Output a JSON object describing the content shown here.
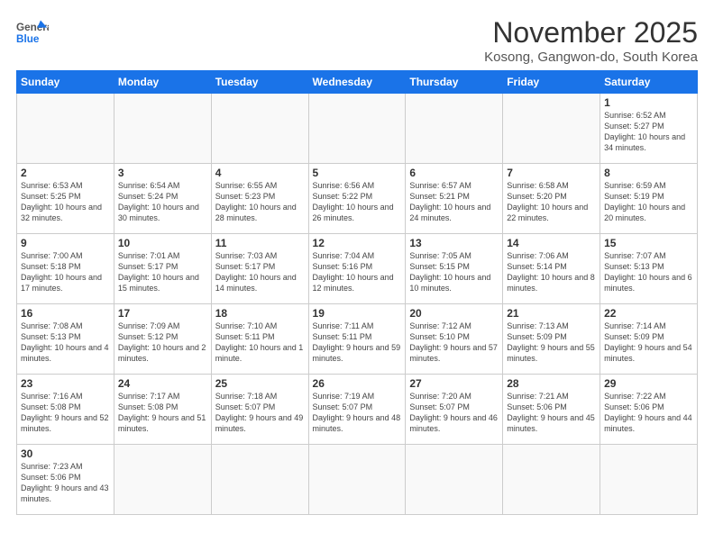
{
  "header": {
    "logo_general": "General",
    "logo_blue": "Blue",
    "title": "November 2025",
    "subtitle": "Kosong, Gangwon-do, South Korea"
  },
  "weekdays": [
    "Sunday",
    "Monday",
    "Tuesday",
    "Wednesday",
    "Thursday",
    "Friday",
    "Saturday"
  ],
  "weeks": [
    [
      {
        "day": "",
        "info": ""
      },
      {
        "day": "",
        "info": ""
      },
      {
        "day": "",
        "info": ""
      },
      {
        "day": "",
        "info": ""
      },
      {
        "day": "",
        "info": ""
      },
      {
        "day": "",
        "info": ""
      },
      {
        "day": "1",
        "info": "Sunrise: 6:52 AM\nSunset: 5:27 PM\nDaylight: 10 hours\nand 34 minutes."
      }
    ],
    [
      {
        "day": "2",
        "info": "Sunrise: 6:53 AM\nSunset: 5:25 PM\nDaylight: 10 hours\nand 32 minutes."
      },
      {
        "day": "3",
        "info": "Sunrise: 6:54 AM\nSunset: 5:24 PM\nDaylight: 10 hours\nand 30 minutes."
      },
      {
        "day": "4",
        "info": "Sunrise: 6:55 AM\nSunset: 5:23 PM\nDaylight: 10 hours\nand 28 minutes."
      },
      {
        "day": "5",
        "info": "Sunrise: 6:56 AM\nSunset: 5:22 PM\nDaylight: 10 hours\nand 26 minutes."
      },
      {
        "day": "6",
        "info": "Sunrise: 6:57 AM\nSunset: 5:21 PM\nDaylight: 10 hours\nand 24 minutes."
      },
      {
        "day": "7",
        "info": "Sunrise: 6:58 AM\nSunset: 5:20 PM\nDaylight: 10 hours\nand 22 minutes."
      },
      {
        "day": "8",
        "info": "Sunrise: 6:59 AM\nSunset: 5:19 PM\nDaylight: 10 hours\nand 20 minutes."
      }
    ],
    [
      {
        "day": "9",
        "info": "Sunrise: 7:00 AM\nSunset: 5:18 PM\nDaylight: 10 hours\nand 17 minutes."
      },
      {
        "day": "10",
        "info": "Sunrise: 7:01 AM\nSunset: 5:17 PM\nDaylight: 10 hours\nand 15 minutes."
      },
      {
        "day": "11",
        "info": "Sunrise: 7:03 AM\nSunset: 5:17 PM\nDaylight: 10 hours\nand 14 minutes."
      },
      {
        "day": "12",
        "info": "Sunrise: 7:04 AM\nSunset: 5:16 PM\nDaylight: 10 hours\nand 12 minutes."
      },
      {
        "day": "13",
        "info": "Sunrise: 7:05 AM\nSunset: 5:15 PM\nDaylight: 10 hours\nand 10 minutes."
      },
      {
        "day": "14",
        "info": "Sunrise: 7:06 AM\nSunset: 5:14 PM\nDaylight: 10 hours\nand 8 minutes."
      },
      {
        "day": "15",
        "info": "Sunrise: 7:07 AM\nSunset: 5:13 PM\nDaylight: 10 hours\nand 6 minutes."
      }
    ],
    [
      {
        "day": "16",
        "info": "Sunrise: 7:08 AM\nSunset: 5:13 PM\nDaylight: 10 hours\nand 4 minutes."
      },
      {
        "day": "17",
        "info": "Sunrise: 7:09 AM\nSunset: 5:12 PM\nDaylight: 10 hours\nand 2 minutes."
      },
      {
        "day": "18",
        "info": "Sunrise: 7:10 AM\nSunset: 5:11 PM\nDaylight: 10 hours\nand 1 minute."
      },
      {
        "day": "19",
        "info": "Sunrise: 7:11 AM\nSunset: 5:11 PM\nDaylight: 9 hours\nand 59 minutes."
      },
      {
        "day": "20",
        "info": "Sunrise: 7:12 AM\nSunset: 5:10 PM\nDaylight: 9 hours\nand 57 minutes."
      },
      {
        "day": "21",
        "info": "Sunrise: 7:13 AM\nSunset: 5:09 PM\nDaylight: 9 hours\nand 55 minutes."
      },
      {
        "day": "22",
        "info": "Sunrise: 7:14 AM\nSunset: 5:09 PM\nDaylight: 9 hours\nand 54 minutes."
      }
    ],
    [
      {
        "day": "23",
        "info": "Sunrise: 7:16 AM\nSunset: 5:08 PM\nDaylight: 9 hours\nand 52 minutes."
      },
      {
        "day": "24",
        "info": "Sunrise: 7:17 AM\nSunset: 5:08 PM\nDaylight: 9 hours\nand 51 minutes."
      },
      {
        "day": "25",
        "info": "Sunrise: 7:18 AM\nSunset: 5:07 PM\nDaylight: 9 hours\nand 49 minutes."
      },
      {
        "day": "26",
        "info": "Sunrise: 7:19 AM\nSunset: 5:07 PM\nDaylight: 9 hours\nand 48 minutes."
      },
      {
        "day": "27",
        "info": "Sunrise: 7:20 AM\nSunset: 5:07 PM\nDaylight: 9 hours\nand 46 minutes."
      },
      {
        "day": "28",
        "info": "Sunrise: 7:21 AM\nSunset: 5:06 PM\nDaylight: 9 hours\nand 45 minutes."
      },
      {
        "day": "29",
        "info": "Sunrise: 7:22 AM\nSunset: 5:06 PM\nDaylight: 9 hours\nand 44 minutes."
      }
    ],
    [
      {
        "day": "30",
        "info": "Sunrise: 7:23 AM\nSunset: 5:06 PM\nDaylight: 9 hours\nand 43 minutes."
      },
      {
        "day": "",
        "info": ""
      },
      {
        "day": "",
        "info": ""
      },
      {
        "day": "",
        "info": ""
      },
      {
        "day": "",
        "info": ""
      },
      {
        "day": "",
        "info": ""
      },
      {
        "day": "",
        "info": ""
      }
    ]
  ]
}
